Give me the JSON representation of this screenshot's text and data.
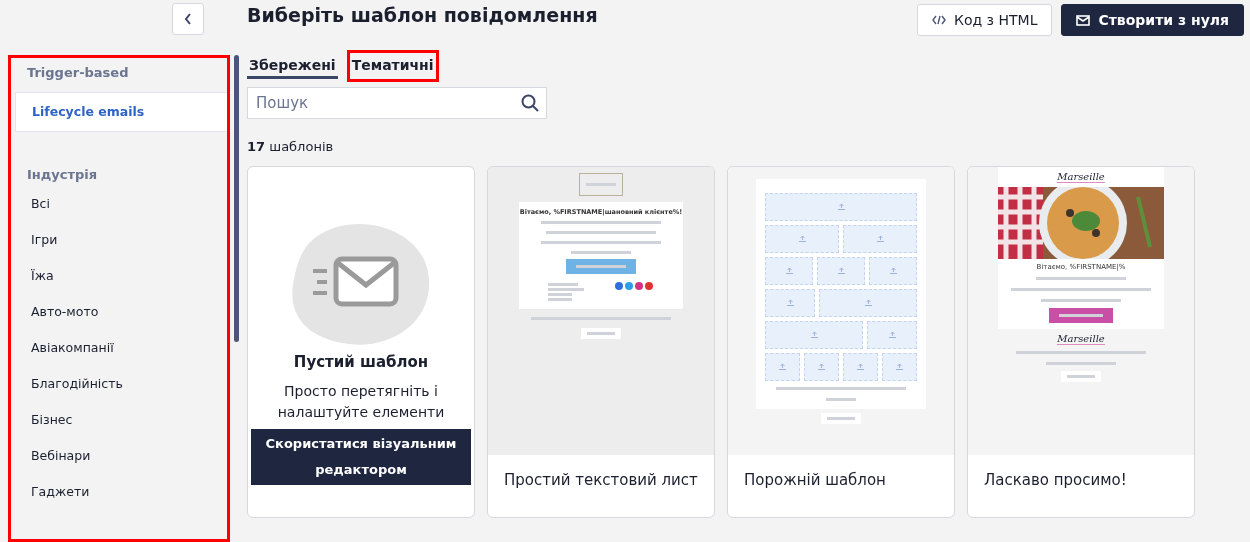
{
  "title": "Виберіть шаблон повідомлення",
  "actions": [
    {
      "label": "Код з HTML",
      "kind": "outline"
    },
    {
      "label": "Створити з нуля",
      "kind": "primary"
    }
  ],
  "sidebar": {
    "highlighted": true,
    "sections": [
      {
        "heading": "Trigger-based",
        "items": [
          {
            "label": "Lifecycle emails",
            "selected": true
          }
        ]
      },
      {
        "heading": "Індустрія",
        "items": [
          {
            "label": "Всі",
            "selected": false
          },
          {
            "label": "Ігри",
            "selected": false
          },
          {
            "label": "Їжа",
            "selected": false
          },
          {
            "label": "Авто-мото",
            "selected": false
          },
          {
            "label": "Авіакомпанії",
            "selected": false
          },
          {
            "label": "Благодійність",
            "selected": false
          },
          {
            "label": "Бізнес",
            "selected": false
          },
          {
            "label": "Вебінари",
            "selected": false
          },
          {
            "label": "Гаджети",
            "selected": false
          }
        ]
      }
    ]
  },
  "tabs": [
    {
      "label": "Збережені",
      "selected": true,
      "highlighted": false
    },
    {
      "label": "Тематичні",
      "selected": false,
      "highlighted": true
    }
  ],
  "search": {
    "placeholder": "Пошук"
  },
  "count": {
    "number": "17",
    "label": "шаблонів"
  },
  "templates": [
    {
      "kind": "blank",
      "title": "Пустий шаблон",
      "description": "Просто перетягніть і налаштуйте елементи",
      "button": "Скористатися візуальним редактором"
    },
    {
      "kind": "text",
      "name": "Простий текстовий лист",
      "heading": "Вітаємо, %FIRSTNAME|шановний клієнте%!"
    },
    {
      "kind": "grid",
      "name": "Порожній шаблон"
    },
    {
      "kind": "welcome",
      "name": "Ласкаво просимо!",
      "logo": "Marseille",
      "heading": "Вітаємо, %FIRSTNAME|%",
      "footer_logo": "Marseille"
    }
  ]
}
